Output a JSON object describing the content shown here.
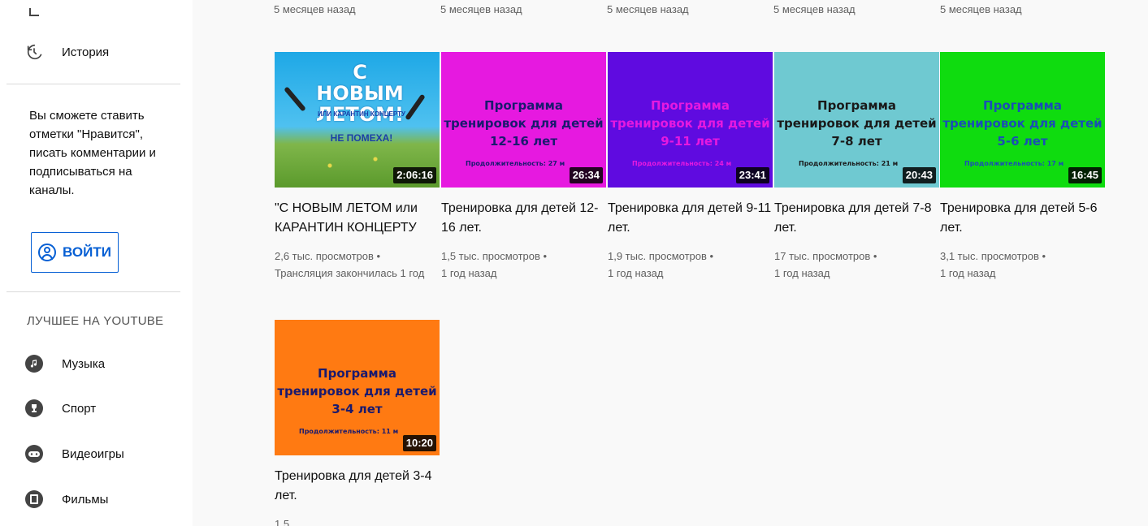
{
  "sidebar": {
    "history": {
      "label": "История",
      "icon": "history-icon"
    },
    "promo_text": "Вы сможете ставить отметки \"Нравится\", писать комментарии и подписываться на каналы.",
    "login_label": "ВОЙТИ",
    "best_title": "ЛУЧШЕЕ НА YOUTUBE",
    "items": [
      {
        "label": "Музыка",
        "icon": "music-icon"
      },
      {
        "label": "Спорт",
        "icon": "trophy-icon"
      },
      {
        "label": "Видеоигры",
        "icon": "gamepad-icon"
      },
      {
        "label": "Фильмы",
        "icon": "film-icon"
      }
    ]
  },
  "prev_row": [
    "5 месяцев назад",
    "5 месяцев назад",
    "5 месяцев назад",
    "5 месяцев назад",
    "5 месяцев назад"
  ],
  "videos": [
    {
      "thumb_big1": "С НОВЫМ ЛЕТОМ!",
      "thumb_small1": "ИЛИ КАРАНТИН КОНЦЕРТУ",
      "thumb_big2": "НЕ ПОМЕХА!",
      "duration": "2:06:16",
      "title": "\"С НОВЫМ ЛЕТОМ или КАРАНТИН КОНЦЕРТУ НЕ...",
      "views": "2,6 тыс. просмотров •",
      "date": "Трансляция закончилась 1 год"
    },
    {
      "thumb_title": "Программа тренировок для детей 12-16 лет",
      "thumb_sub": "Продолжительность: 27 м",
      "duration": "26:34",
      "title": "Тренировка для детей 12-16 лет.",
      "views": "1,5 тыс. просмотров •",
      "date": "1 год назад",
      "bg": "#e619e0",
      "fg": "#1a1a6e"
    },
    {
      "thumb_title": "Программа тренировок для детей 9-11 лет",
      "thumb_sub": "Продолжительность: 24 м",
      "duration": "23:41",
      "title": "Тренировка для детей 9-11 лет.",
      "views": "1,9 тыс. просмотров •",
      "date": "1 год назад",
      "bg": "#5f0be0",
      "fg": "#e619e0"
    },
    {
      "thumb_title": "Программа тренировок для детей 7-8 лет",
      "thumb_sub": "Продолжительность: 21 м",
      "duration": "20:43",
      "title": "Тренировка для детей 7-8 лет.",
      "views": "17 тыс. просмотров •",
      "date": "1 год назад",
      "bg": "#6fc9d1",
      "fg": "#1a1a1a"
    },
    {
      "thumb_title": "Программа тренировок для детей 5-6 лет",
      "thumb_sub": "Продолжительность: 17 м",
      "duration": "16:45",
      "title": "Тренировка для детей 5-6 лет.",
      "views": "3,1 тыс. просмотров •",
      "date": "1 год назад",
      "bg": "#0fdc0f",
      "fg": "#1a4fb5"
    },
    {
      "thumb_title": "Программа тренировок для детей 3-4 лет",
      "thumb_sub": "Продолжительность: 11 м",
      "duration": "10:20",
      "title": "Тренировка для детей 3-4 лет.",
      "views": "1,5",
      "bg": "#ff7a12",
      "fg": "#1a1a6e"
    }
  ]
}
